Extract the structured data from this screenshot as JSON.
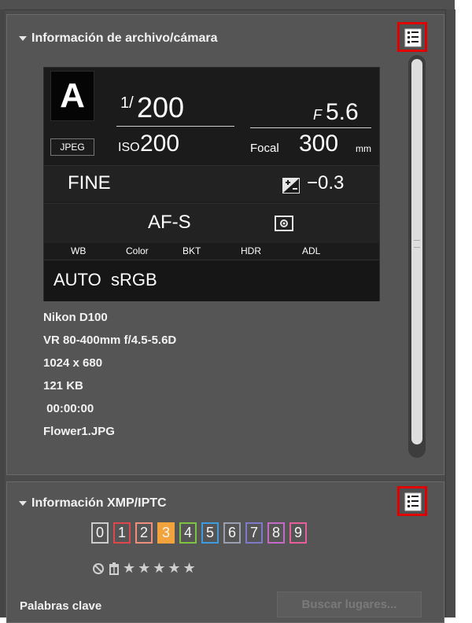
{
  "file_camera_panel": {
    "title": "Información de archivo/cámara",
    "display": {
      "mode": "A",
      "shutter_prefix": "1/",
      "shutter": "200",
      "aperture_prefix": "F",
      "aperture": "5.6",
      "image_format": "JPEG",
      "iso_label": "ISO",
      "iso": "200",
      "focal_label": "Focal",
      "focal_length": "300",
      "focal_unit": "mm",
      "quality": "FINE",
      "exposure_comp": "−0.3",
      "focus_mode": "AF-S",
      "labels": {
        "wb": "WB",
        "color": "Color",
        "bkt": "BKT",
        "hdr": "HDR",
        "adl": "ADL"
      },
      "wb_value": "AUTO",
      "color_value": "sRGB"
    },
    "info": {
      "camera": "Nikon D100",
      "lens": "VR 80-400mm f/4.5-5.6D",
      "dimensions": "1024 x 680",
      "file_size": "121 KB",
      "time": " 00:00:00",
      "filename": "Flower1.JPG"
    }
  },
  "xmp_panel": {
    "title": "Información XMP/IPTC",
    "labels": [
      {
        "text": "0",
        "color": "#cccccc"
      },
      {
        "text": "1",
        "color": "#e0474c"
      },
      {
        "text": "2",
        "color": "#ee8f7c"
      },
      {
        "text": "3",
        "color": "#f3a33b"
      },
      {
        "text": "4",
        "color": "#7fc241"
      },
      {
        "text": "5",
        "color": "#3f9be0"
      },
      {
        "text": "6",
        "color": "#9aa0b0"
      },
      {
        "text": "7",
        "color": "#7e79c9"
      },
      {
        "text": "8",
        "color": "#c36ac4"
      },
      {
        "text": "9",
        "color": "#e85e9c"
      }
    ],
    "selected_label": "3",
    "rating_stars": "★★★★★",
    "keywords_label": "Palabras clave",
    "search_places_button": "Buscar lugares..."
  },
  "colors": {
    "highlight_border": "#e00000",
    "selected_label_fill": "#f3a33b"
  }
}
